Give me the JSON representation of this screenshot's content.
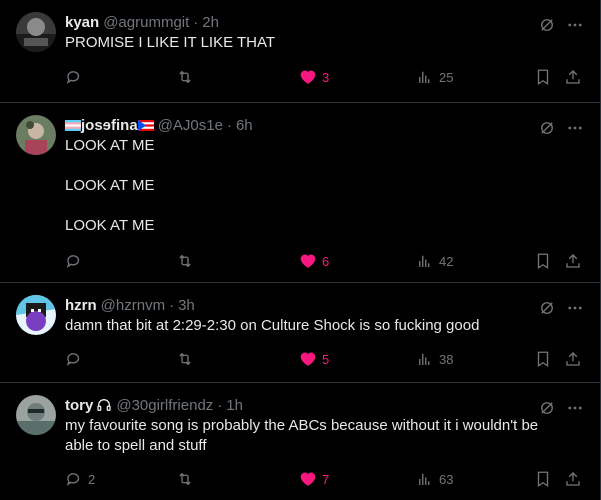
{
  "posts": [
    {
      "name": "kyan",
      "handle": "@agrummgit",
      "time": "2h",
      "text": "PROMISE I LIKE IT LIKE THAT",
      "replies": "",
      "retweets": "",
      "likes": "3",
      "views": "25",
      "liked": true
    },
    {
      "name": "josɘfina",
      "handle": "@AJ0s1e",
      "time": "6h",
      "text": "LOOK AT ME\n\nLOOK AT ME\n\nLOOK AT ME",
      "replies": "",
      "retweets": "",
      "likes": "6",
      "views": "42",
      "liked": true
    },
    {
      "name": "hzrn",
      "handle": "@hzrnvm",
      "time": "3h",
      "text": "damn that bit at 2:29-2:30 on Culture Shock is so fucking good",
      "replies": "",
      "retweets": "",
      "likes": "5",
      "views": "38",
      "liked": true
    },
    {
      "name": "tory",
      "handle": "@30girlfriendz",
      "time": "1h",
      "text": "my favourite song is probably the ABCs because without it i wouldn't be able to spell and stuff",
      "replies": "2",
      "retweets": "",
      "likes": "7",
      "views": "63",
      "liked": true
    }
  ],
  "dot": "·",
  "colors": {
    "background": "#000000",
    "text": "#e7e9ea",
    "muted": "#71767b",
    "like": "#f91880",
    "divider": "#2f3336"
  },
  "icons": [
    "reply-icon",
    "retweet-icon",
    "heart-icon",
    "views-icon",
    "bookmark-icon",
    "share-icon",
    "grok-icon",
    "more-icon",
    "headphones-icon",
    "trans-flag-icon",
    "puerto-rico-flag-icon"
  ]
}
